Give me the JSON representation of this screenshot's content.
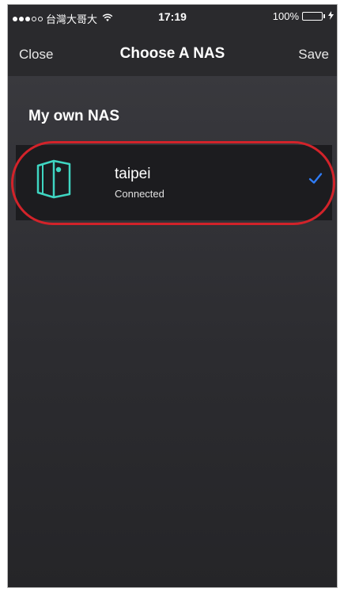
{
  "status_bar": {
    "carrier": "台灣大哥大",
    "time": "17:19",
    "battery_text": "100%",
    "signal_bars_filled": 3,
    "signal_bars_total": 5,
    "battery_level": 1.0,
    "battery_color": "#3ddc55"
  },
  "navbar": {
    "close_label": "Close",
    "title": "Choose A NAS",
    "save_label": "Save"
  },
  "section": {
    "header": "My own NAS"
  },
  "nas_list": [
    {
      "name": "taipei",
      "status": "Connected",
      "selected": true,
      "icon": "nas-device-icon"
    }
  ],
  "colors": {
    "accent": "#2f7cf6",
    "device_icon": "#3fd6c2",
    "highlight": "#d2232a"
  }
}
